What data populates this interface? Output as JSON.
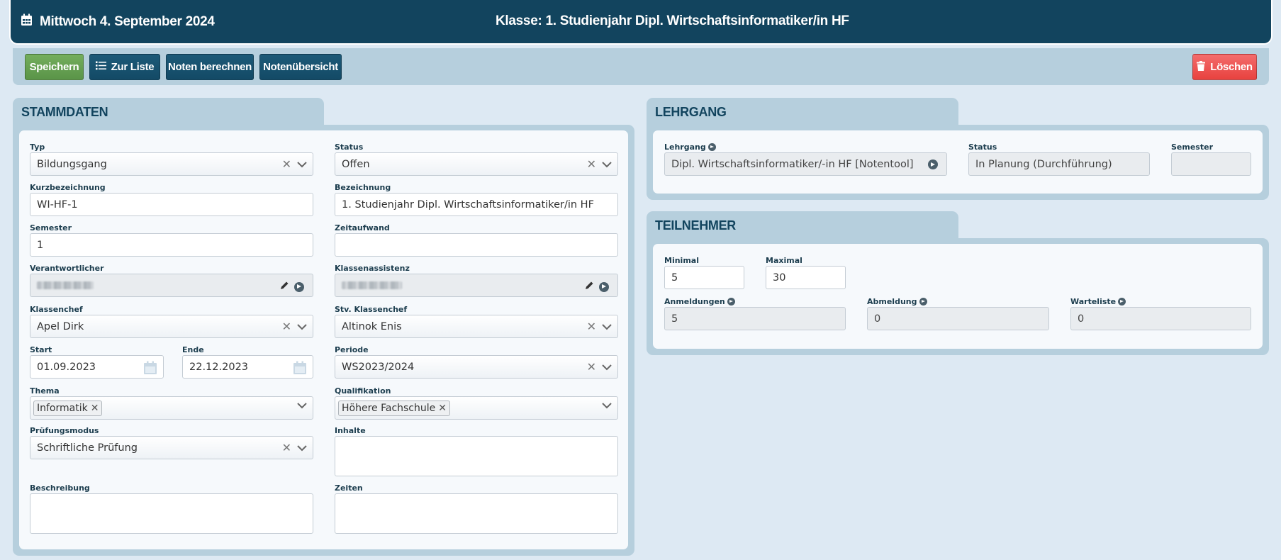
{
  "header": {
    "date": "Mittwoch 4. September 2024",
    "title": "Klasse: 1. Studienjahr Dipl. Wirtschaftsinformatiker/in HF",
    "icon": "calendar-icon"
  },
  "toolbar": {
    "save": "Speichern",
    "to_list": "Zur Liste",
    "calc_grades": "Noten berechnen",
    "grade_overview": "Notenübersicht",
    "delete": "Löschen"
  },
  "stammdaten": {
    "title": "STAMMDATEN",
    "typ": {
      "label": "Typ",
      "value": "Bildungsgang"
    },
    "status": {
      "label": "Status",
      "value": "Offen"
    },
    "kurzbezeichnung": {
      "label": "Kurzbezeichnung",
      "value": "WI-HF-1"
    },
    "bezeichnung": {
      "label": "Bezeichnung",
      "value": "1. Studienjahr Dipl. Wirtschaftsinformatiker/in HF"
    },
    "semester": {
      "label": "Semester",
      "value": "1"
    },
    "zeitaufwand": {
      "label": "Zeitaufwand",
      "value": ""
    },
    "verantwortlicher": {
      "label": "Verantwortlicher"
    },
    "klassenassistenz": {
      "label": "Klassenassistenz"
    },
    "klassenchef": {
      "label": "Klassenchef",
      "value": "Apel Dirk"
    },
    "stv_klassenchef": {
      "label": "Stv. Klassenchef",
      "value": "Altinok Enis"
    },
    "start": {
      "label": "Start",
      "value": "01.09.2023"
    },
    "ende": {
      "label": "Ende",
      "value": "22.12.2023"
    },
    "periode": {
      "label": "Periode",
      "value": "WS2023/2024"
    },
    "thema": {
      "label": "Thema",
      "tag": "Informatik"
    },
    "qualifikation": {
      "label": "Qualifikation",
      "tag": "Höhere Fachschule"
    },
    "pruefungsmodus": {
      "label": "Prüfungsmodus",
      "value": "Schriftliche Prüfung"
    },
    "inhalte": {
      "label": "Inhalte",
      "value": ""
    },
    "beschreibung": {
      "label": "Beschreibung",
      "value": ""
    },
    "zeiten": {
      "label": "Zeiten",
      "value": ""
    }
  },
  "lehrgang": {
    "title": "LEHRGANG",
    "lehrgang": {
      "label": "Lehrgang",
      "value": "Dipl. Wirtschaftsinformatiker/-in HF [Notentool]"
    },
    "status": {
      "label": "Status",
      "value": "In Planung (Durchführung)"
    },
    "semester": {
      "label": "Semester",
      "value": ""
    }
  },
  "teilnehmer": {
    "title": "TEILNEHMER",
    "minimal": {
      "label": "Minimal",
      "value": "5"
    },
    "maximal": {
      "label": "Maximal",
      "value": "30"
    },
    "anmeldungen": {
      "label": "Anmeldungen",
      "value": "5"
    },
    "abmeldung": {
      "label": "Abmeldung",
      "value": "0"
    },
    "warteliste": {
      "label": "Warteliste",
      "value": "0"
    }
  },
  "colors": {
    "header_bg": "#12445e",
    "panel_bg": "#b6cfdd",
    "save_green": "#5a9448",
    "delete_red": "#e8423f"
  }
}
